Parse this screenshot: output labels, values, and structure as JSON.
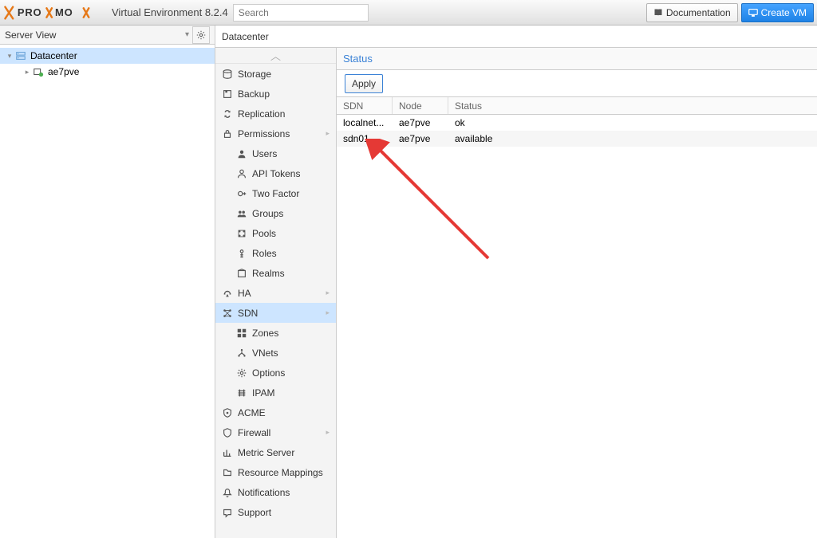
{
  "header": {
    "product": "Virtual Environment 8.2.4",
    "search_placeholder": "Search",
    "doc_label": "Documentation",
    "create_vm_label": "Create VM"
  },
  "tree": {
    "view_label": "Server View",
    "root": "Datacenter",
    "node": "ae7pve"
  },
  "breadcrumb": "Datacenter",
  "sidenav": {
    "items": [
      {
        "label": "Storage",
        "icon": "storage"
      },
      {
        "label": "Backup",
        "icon": "backup"
      },
      {
        "label": "Replication",
        "icon": "replication"
      },
      {
        "label": "Permissions",
        "icon": "permissions",
        "expandable": true
      },
      {
        "label": "Users",
        "icon": "user",
        "sub": true
      },
      {
        "label": "API Tokens",
        "icon": "token",
        "sub": true
      },
      {
        "label": "Two Factor",
        "icon": "twofactor",
        "sub": true
      },
      {
        "label": "Groups",
        "icon": "groups",
        "sub": true
      },
      {
        "label": "Pools",
        "icon": "pools",
        "sub": true
      },
      {
        "label": "Roles",
        "icon": "roles",
        "sub": true
      },
      {
        "label": "Realms",
        "icon": "realms",
        "sub": true
      },
      {
        "label": "HA",
        "icon": "ha",
        "expandable": true
      },
      {
        "label": "SDN",
        "icon": "sdn",
        "expandable": true,
        "selected": true
      },
      {
        "label": "Zones",
        "icon": "zones",
        "sub": true
      },
      {
        "label": "VNets",
        "icon": "vnets",
        "sub": true
      },
      {
        "label": "Options",
        "icon": "options",
        "sub": true
      },
      {
        "label": "IPAM",
        "icon": "ipam",
        "sub": true
      },
      {
        "label": "ACME",
        "icon": "acme"
      },
      {
        "label": "Firewall",
        "icon": "firewall",
        "expandable": true
      },
      {
        "label": "Metric Server",
        "icon": "metric"
      },
      {
        "label": "Resource Mappings",
        "icon": "mappings"
      },
      {
        "label": "Notifications",
        "icon": "notifications"
      },
      {
        "label": "Support",
        "icon": "support"
      }
    ]
  },
  "content": {
    "section_title": "Status",
    "apply_label": "Apply",
    "columns": {
      "sdn": "SDN",
      "node": "Node",
      "status": "Status"
    },
    "rows": [
      {
        "sdn": "localnet...",
        "node": "ae7pve",
        "status": "ok"
      },
      {
        "sdn": "sdn01",
        "node": "ae7pve",
        "status": "available"
      }
    ]
  }
}
